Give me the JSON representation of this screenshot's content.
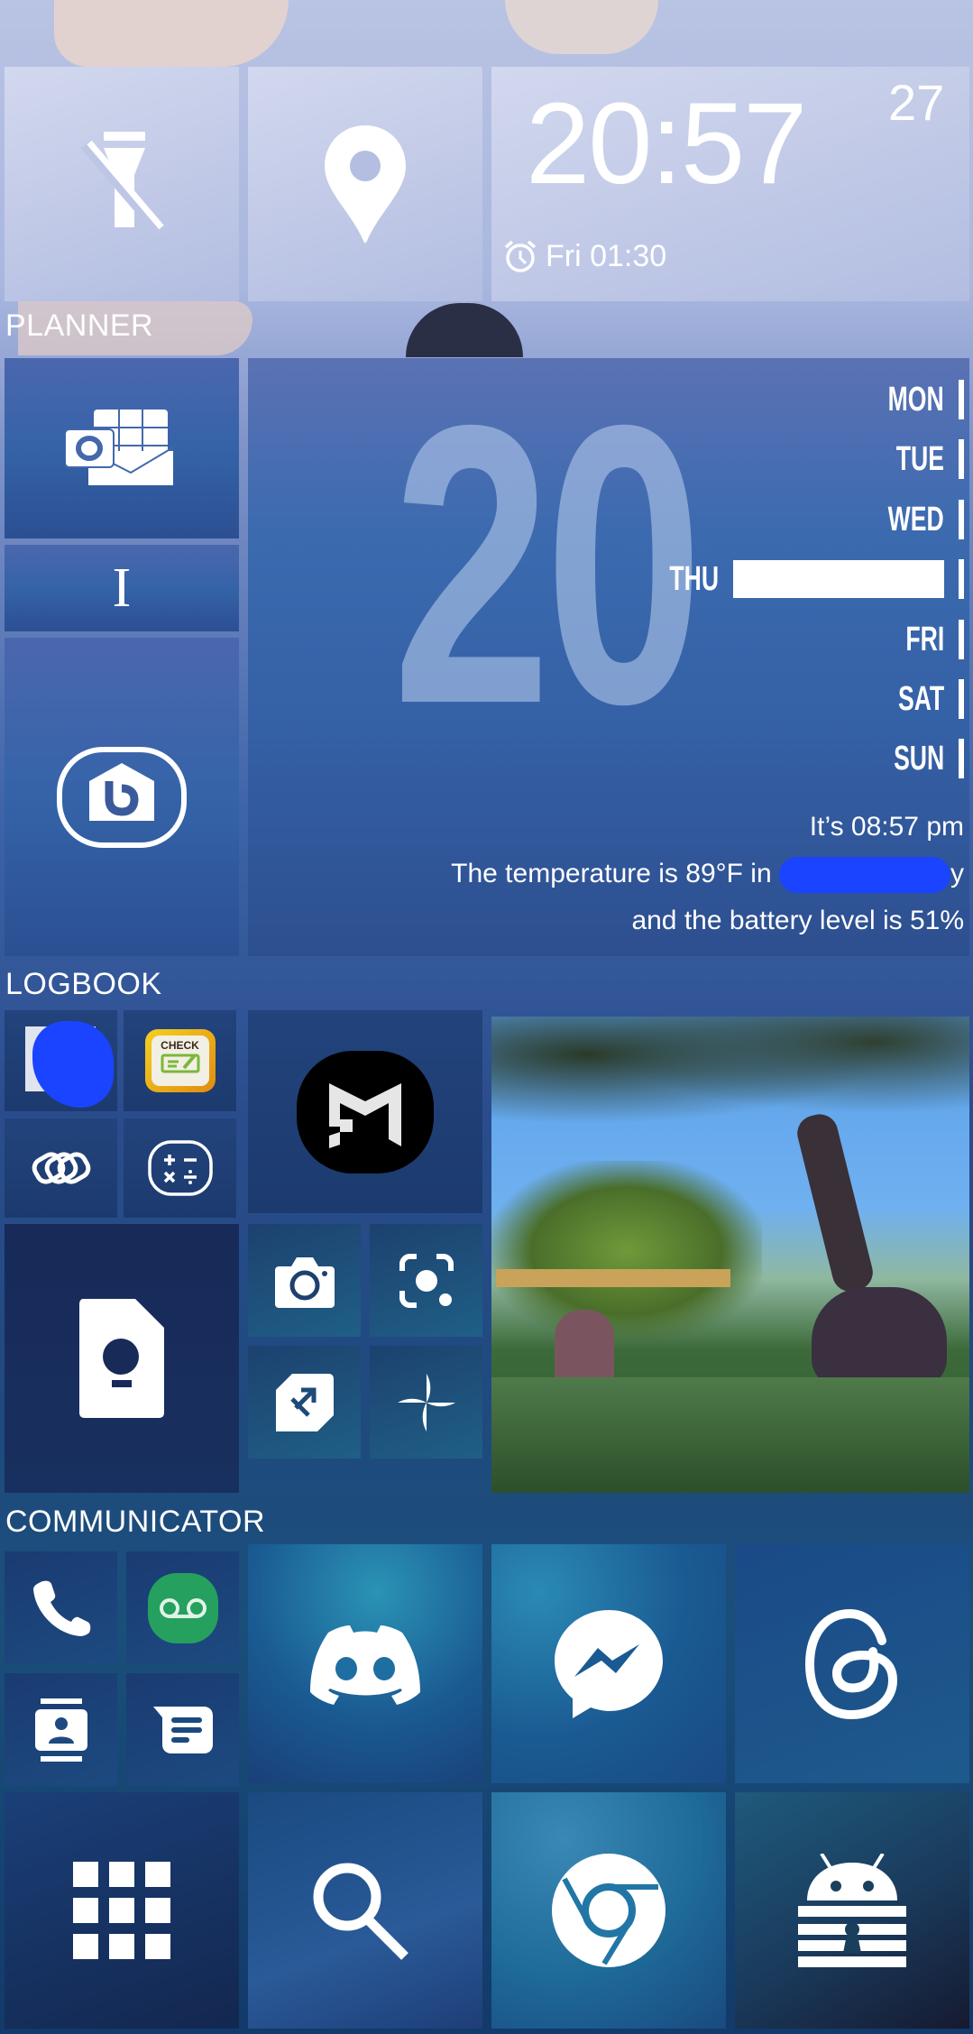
{
  "screen": "Android launcher home screen (tile layout)",
  "quick_tiles": {
    "flashlight": {
      "icon": "flashlight-off-icon"
    },
    "location": {
      "icon": "location-pin-icon"
    }
  },
  "clock": {
    "time": "20:57",
    "seconds": "27",
    "alarm_icon": "alarm-clock-icon",
    "next_alarm": "Fri 01:30"
  },
  "sections": {
    "planner": "PLANNER",
    "logbook": "LOGBOOK",
    "communicator": "COMMUNICATOR"
  },
  "planner": {
    "apps": [
      {
        "name": "Outlook",
        "icon": "outlook-icon"
      },
      {
        "name": "Instapaper",
        "icon": "serif-i-icon",
        "glyph": "I"
      },
      {
        "name": "Bixby Home",
        "icon": "bixby-home-icon"
      }
    ],
    "calendar_widget": {
      "day_number": "20",
      "days": [
        "MON",
        "TUE",
        "WED",
        "THU",
        "FRI",
        "SAT",
        "SUN"
      ],
      "current_day": "THU",
      "time_line": "It’s 08:57 pm",
      "temperature_prefix": "The temperature is 89°F in",
      "temperature_suffix": "y",
      "battery_line": "and the battery level is 51%"
    }
  },
  "logbook": {
    "apps": [
      {
        "name": "Redacted app",
        "icon": "redacted-app-icon"
      },
      {
        "name": "Check",
        "icon": "check-app-icon",
        "label": "CHECK"
      },
      {
        "name": "Linked",
        "icon": "chain-links-icon"
      },
      {
        "name": "Calculator",
        "icon": "calculator-icon"
      },
      {
        "name": "M app",
        "icon": "m-logo-icon"
      },
      {
        "name": "Keep Notes",
        "icon": "keep-notes-icon"
      },
      {
        "name": "Camera",
        "icon": "camera-icon"
      },
      {
        "name": "Lens",
        "icon": "lens-icon"
      },
      {
        "name": "Share",
        "icon": "quick-share-icon"
      },
      {
        "name": "Pinwheel",
        "icon": "pinwheel-icon"
      }
    ],
    "photo_widget": {
      "description": "Giraffe and gorilla sculptures in garden"
    }
  },
  "communicator": {
    "apps": [
      {
        "name": "Phone",
        "icon": "phone-icon"
      },
      {
        "name": "Voicemail",
        "icon": "voicemail-icon"
      },
      {
        "name": "Contacts",
        "icon": "contacts-icon"
      },
      {
        "name": "Messages",
        "icon": "messages-icon"
      },
      {
        "name": "Discord",
        "icon": "discord-icon"
      },
      {
        "name": "Messenger",
        "icon": "messenger-icon"
      },
      {
        "name": "Threads",
        "icon": "threads-icon"
      }
    ]
  },
  "dock": {
    "apps": [
      {
        "name": "App drawer",
        "icon": "app-grid-icon"
      },
      {
        "name": "Search",
        "icon": "search-icon"
      },
      {
        "name": "Chrome",
        "icon": "chrome-icon"
      },
      {
        "name": "Keepass",
        "icon": "android-lock-icon"
      }
    ]
  },
  "colors": {
    "voicemail_green": "#25a05f",
    "check_orange": "#f0a820",
    "redact_blue": "#1a44ff"
  }
}
